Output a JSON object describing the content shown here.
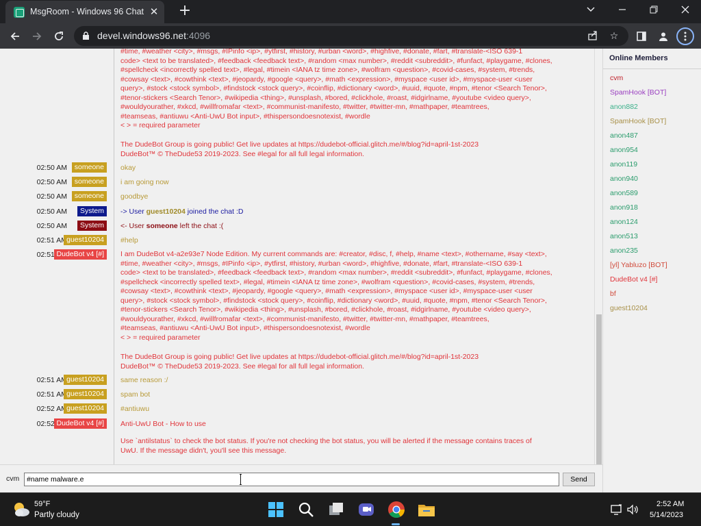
{
  "browser": {
    "tab_title": "MsgRoom - Windows 96 Chat",
    "url_host": "devel.windows96.net",
    "url_port": ":4096"
  },
  "help_text": {
    "lines_top": [
      "#time, #weather <city>, #msgs, #IPinfo <ip>, #ytfirst, #history, #urban <word>, #highfive, #donate, #fart, #translate-<ISO 639-1",
      "code> <text to be translated>, #feedback <feedback text>, #random <max number>, #reddit <subreddit>, #funfact, #playgame, #clones,",
      "#spellcheck <incorrectly spelled text>, #legal, #timein <IANA tz time zone>, #wolfram <question>, #covid-cases, #system, #trends,",
      "#cowsay <text>, #cowthink <text>, #jeopardy, #google <query>, #math <expression>, #myspace <user id>, #myspace-user <user",
      "query>, #stock <stock symbol>, #findstock <stock query>, #coinflip, #dictionary <word>, #uuid, #quote, #npm, #tenor <Search Tenor>,",
      "#tenor-stickers <Search Tenor>, #wikipedia <thing>, #unsplash, #bored, #clickhole, #roast, #idgirlname, #youtube <video query>,",
      "#wouldyourather, #xkcd, #willfromafar <text>, #communist-manifesto, #twitter, #twitter-mn, #mathpaper, #teamtrees,",
      "#teamseas, #antiuwu <Anti-UwU Bot input>, #thispersondoesnotexist, #wordle",
      "< > = required parameter"
    ],
    "group_line": "The DudeBot Group is going public! Get live updates at https://dudebot-official.glitch.me/#/blog?id=april-1st-2023",
    "copyright_line": "DudeBot™ © TheDude53 2019-2023. See #legal for all full legal information.",
    "help_intro": "I am DudeBot v4-a2e93e7 Node Edition. My current commands are: #creator, #disc, f, #help, #name <text>, #othername, #say <text>,",
    "antiuwu_title": "Anti-UwU Bot - How to use",
    "antiuwu_body_1": "Use `antilstatus` to check the bot status. If you're not checking the bot status, you will be alerted if the message contains traces of",
    "antiuwu_body_2": "UwU. If the message didn't, you'll see this message."
  },
  "messages": [
    {
      "time": "02:50 AM",
      "user": "someone",
      "badge_color": "#c8a020",
      "text": "okay",
      "text_color": "#b89a38"
    },
    {
      "time": "02:50 AM",
      "user": "someone",
      "badge_color": "#c8a020",
      "text": "i am going now",
      "text_color": "#b89a38"
    },
    {
      "time": "02:50 AM",
      "user": "someone",
      "badge_color": "#c8a020",
      "text": "goodbye",
      "text_color": "#b89a38"
    },
    {
      "time": "02:50 AM",
      "user": "System",
      "badge_color": "#0d1a8c",
      "text_pre": "-> User ",
      "text_user": "guest10204",
      "text_post": " joined the chat :D",
      "text_color": "#1a1aa0",
      "user_color": "#a08a28"
    },
    {
      "time": "02:50 AM",
      "user": "System",
      "badge_color": "#8c0d14",
      "text_pre": "<- User ",
      "text_user": "someone",
      "text_post": " left the chat :(",
      "text_color": "#8c0d14",
      "user_color": "#8c0d14"
    },
    {
      "time": "02:51 AM",
      "user": "guest10204",
      "badge_color": "#c8a020",
      "text": "#help",
      "text_color": "#b89a38"
    },
    {
      "time": "02:51 AM",
      "user": "DudeBot v4 [#]",
      "badge_color": "#e84545"
    },
    {
      "time": "02:51 AM",
      "user": "guest10204",
      "badge_color": "#c8a020",
      "text": "same reason :/",
      "text_color": "#b89a38"
    },
    {
      "time": "02:51 AM",
      "user": "guest10204",
      "badge_color": "#c8a020",
      "text": "spam bot",
      "text_color": "#b89a38"
    },
    {
      "time": "02:52 AM",
      "user": "guest10204",
      "badge_color": "#c8a020",
      "text": "#antiuwu",
      "text_color": "#b89a38"
    },
    {
      "time": "02:52 AM",
      "user": "DudeBot v4 [#]",
      "badge_color": "#e84545",
      "text": "Anti-UwU Bot - How to use",
      "text_color": "#e0343a"
    }
  ],
  "members": {
    "title": "Online Members",
    "list": [
      {
        "name": "cvm",
        "color": "#c0202a"
      },
      {
        "name": "SpamHook [BOT]",
        "color": "#9a3fc0"
      },
      {
        "name": "anon882",
        "color": "#3bb08a"
      },
      {
        "name": "SpamHook [BOT]",
        "color": "#a89048"
      },
      {
        "name": "anon487",
        "color": "#2a9c6c"
      },
      {
        "name": "anon954",
        "color": "#2a9c6c"
      },
      {
        "name": "anon119",
        "color": "#2a9c6c"
      },
      {
        "name": "anon940",
        "color": "#2a9c6c"
      },
      {
        "name": "anon589",
        "color": "#2a9c6c"
      },
      {
        "name": "anon918",
        "color": "#2a9c6c"
      },
      {
        "name": "anon124",
        "color": "#2a9c6c"
      },
      {
        "name": "anon513",
        "color": "#2a9c6c"
      },
      {
        "name": "anon235",
        "color": "#2a9c6c"
      },
      {
        "name": "[yl] Yabluzo [BOT]",
        "color": "#d04a3a"
      },
      {
        "name": "DudeBot v4 [#]",
        "color": "#e0343a"
      },
      {
        "name": "bf",
        "color": "#d04a3a"
      },
      {
        "name": "guest10204",
        "color": "#a89048"
      }
    ]
  },
  "input": {
    "username": "cvm",
    "value": "#name malware.e",
    "send_label": "Send"
  },
  "taskbar": {
    "temperature": "59°F",
    "weather": "Partly cloudy",
    "time": "2:52 AM",
    "date": "5/14/2023"
  }
}
